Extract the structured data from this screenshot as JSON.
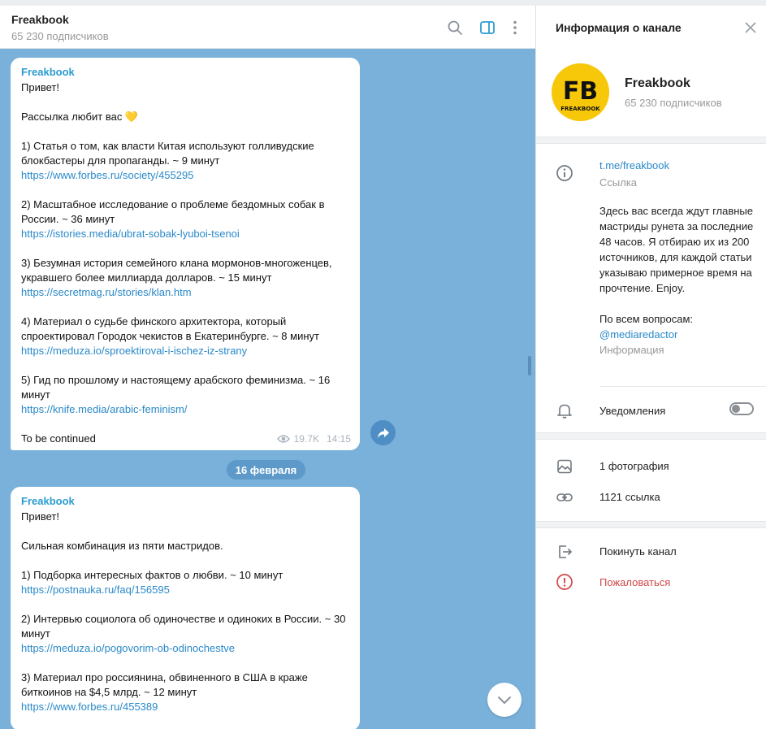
{
  "chat": {
    "title": "Freakbook",
    "subtitle": "65 230 подписчиков",
    "header_icons": [
      "search-icon",
      "sidebar-toggle-icon",
      "more-vertical-icon"
    ]
  },
  "messages": [
    {
      "author": "Freakbook",
      "lines": [
        "Привет!",
        "",
        "Рассылка любит вас 💛",
        "",
        "1) Статья о том, как власти Китая используют голливудские блокбастеры для пропаганды. ~ 9 минут",
        "https://www.forbes.ru/society/455295",
        "",
        "2) Масштабное исследование о проблеме бездомных собак в России. ~ 36 минут",
        "https://istories.media/ubrat-sobak-lyuboi-tsenoi",
        "",
        "3) Безумная история семейного клана мормонов-многоженцев, укравшего более миллиарда долларов. ~ 15 минут",
        "https://secretmag.ru/stories/klan.htm",
        "",
        "4) Материал о судьбе финского архитектора, который спроектировал Городок чекистов в Екатеринбурге. ~ 8 минут",
        "https://meduza.io/sproektiroval-i-ischez-iz-strany",
        "",
        "5) Гид по прошлому и настоящему арабского феминизма. ~ 16 минут",
        "https://knife.media/arabic-feminism/",
        "",
        "To be continued"
      ],
      "views": "19.7K",
      "time": "14:15"
    },
    {
      "author": "Freakbook",
      "lines": [
        "Привет!",
        "",
        "Сильная комбинация из пяти мастридов.",
        "",
        "1) Подборка интересных фактов о любви. ~ 10 минут",
        "https://postnauka.ru/faq/156595",
        "",
        "2) Интервью социолога об одиночестве и одиноких в России. ~ 30 минут",
        "https://meduza.io/pogovorim-ob-odinochestve",
        "",
        "3) Материал про россиянина, обвиненного в США в краже биткоинов на $4,5 млрд. ~ 12 минут",
        "https://www.forbes.ru/455389"
      ]
    }
  ],
  "date_separator": "16 февраля",
  "panel": {
    "title": "Информация о канале",
    "channel_name": "Freakbook",
    "subscribers": "65 230 подписчиков",
    "avatar_logo_text": "FB",
    "avatar_caption": "FREAKBOOK",
    "link": "t.me/freakbook",
    "link_caption": "Ссылка",
    "description": [
      "Здесь вас всегда ждут главные мастриды рунета за последние 48 часов. Я отбираю их из 200 источников, для каждой статьи указываю примерное время на прочтение. Enjoy.",
      "",
      "По всем вопросам:"
    ],
    "contact": "@mediaredactor",
    "description_caption": "Информация",
    "notifications_label": "Уведомления",
    "notifications_on": false,
    "photos": "1 фотография",
    "links_count": "1121 ссылка",
    "leave": "Покинуть канал",
    "report": "Пожаловаться"
  },
  "colors": {
    "accent": "#2a9bd0",
    "chat_background": "#79b1da",
    "report": "#d14848",
    "avatar_yellow": "#f7c80a"
  }
}
